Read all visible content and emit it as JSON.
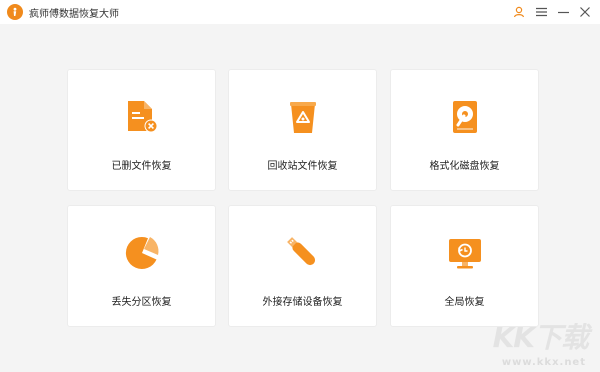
{
  "window": {
    "title": "疯师傅数据恢复大师",
    "logo_icon": "app-logo-icon"
  },
  "controls": [
    {
      "name": "user-icon"
    },
    {
      "name": "menu-icon"
    },
    {
      "name": "minimize-icon"
    },
    {
      "name": "close-icon"
    }
  ],
  "accent_color": "#f08a1c",
  "cards": [
    {
      "label": "已删文件恢复",
      "icon": "deleted-file-icon"
    },
    {
      "label": "回收站文件恢复",
      "icon": "recycle-bin-icon"
    },
    {
      "label": "格式化磁盘恢复",
      "icon": "formatted-disk-icon"
    },
    {
      "label": "丢失分区恢复",
      "icon": "lost-partition-icon"
    },
    {
      "label": "外接存储设备恢复",
      "icon": "usb-drive-icon"
    },
    {
      "label": "全局恢复",
      "icon": "full-scan-monitor-icon"
    }
  ],
  "watermark": {
    "text": "KK下载",
    "url": "www.kkx.net"
  }
}
